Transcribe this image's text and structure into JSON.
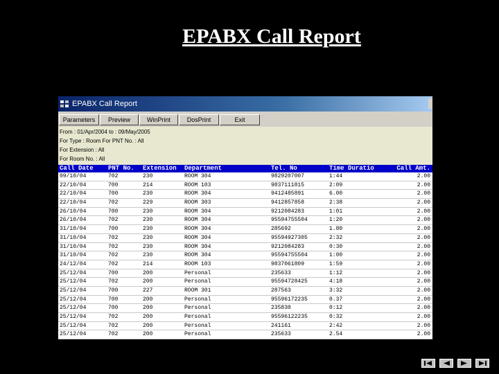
{
  "slide": {
    "title": "EPABX Call Report"
  },
  "window": {
    "title": "EPABX Call Report"
  },
  "toolbar": [
    {
      "label": "Parameters",
      "name": "parameters-button",
      "w": 58
    },
    {
      "label": "Preview",
      "name": "preview-button",
      "w": 56
    },
    {
      "label": "WinPrint",
      "name": "winprint-button",
      "w": 56
    },
    {
      "label": "DosPrint",
      "name": "dosprint-button",
      "w": 58
    },
    {
      "label": "Exit",
      "name": "exit-button",
      "w": 58
    }
  ],
  "params": [
    "From : 01/Apr/2004 to : 09/May/2005",
    "For Type : Room     For PNT No. : All",
    "For Extension : All",
    "For Room No. : All"
  ],
  "columns": [
    "Call Date",
    "PNT No.",
    "Extension",
    "Department",
    "Tel. No",
    "Time Duratio",
    "Call Amt."
  ],
  "rows": [
    [
      "09/10/04",
      "702",
      "230",
      "ROOM 304",
      "9829207007",
      "1:44",
      "2.00"
    ],
    [
      "22/10/04",
      "700",
      "214",
      "ROOM 103",
      "9837111815",
      "2:09",
      "2.00"
    ],
    [
      "22/10/04",
      "700",
      "230",
      "ROOM 304",
      "9412485891",
      "6.00",
      "2.00"
    ],
    [
      "22/10/04",
      "702",
      "229",
      "ROOM 303",
      "9412857858",
      "2:38",
      "2.00"
    ],
    [
      "26/10/04",
      "700",
      "230",
      "ROOM 304",
      "9212084283",
      "1:01",
      "2.00"
    ],
    [
      "26/10/04",
      "702",
      "230",
      "ROOM 304",
      "95594755504",
      "1:20",
      "2.00"
    ],
    [
      "31/10/04",
      "700",
      "230",
      "ROOM 304",
      "285692",
      "1.80",
      "2.00"
    ],
    [
      "31/10/04",
      "702",
      "230",
      "ROOM 304",
      "95594927305",
      "2:32",
      "2.00"
    ],
    [
      "31/10/04",
      "702",
      "230",
      "ROOM 304",
      "9212084283",
      "0:30",
      "2.00"
    ],
    [
      "31/10/04",
      "702",
      "230",
      "ROOM 304",
      "95594755504",
      "1:00",
      "2.00"
    ],
    [
      "24/12/04",
      "702",
      "214",
      "ROOM 103",
      "9837061809",
      "1:59",
      "2.00"
    ],
    [
      "25/12/04",
      "700",
      "200",
      "Personal",
      "235633",
      "1:12",
      "2.00"
    ],
    [
      "25/12/04",
      "702",
      "200",
      "Personal",
      "95594728425",
      "4:18",
      "2.00"
    ],
    [
      "25/12/04",
      "700",
      "227",
      "ROOM 301",
      "287563",
      "3:32",
      "2.00"
    ],
    [
      "25/12/04",
      "700",
      "200",
      "Personal",
      "95596172235",
      "0.37",
      "2.00"
    ],
    [
      "25/12/04",
      "700",
      "200",
      "Personal",
      "235830",
      "0:12",
      "2.00"
    ],
    [
      "25/12/04",
      "702",
      "200",
      "Personal",
      "95596122235",
      "0:32",
      "2.00"
    ],
    [
      "25/12/04",
      "702",
      "200",
      "Personal",
      "241161",
      "2:42",
      "2.00"
    ],
    [
      "25/12/04",
      "702",
      "200",
      "Personal",
      "235633",
      "2.54",
      "2.00"
    ]
  ],
  "nav": [
    {
      "name": "first-slide-button",
      "icon": "first-icon"
    },
    {
      "name": "previous-slide-button",
      "icon": "previous-icon"
    },
    {
      "name": "next-slide-button",
      "icon": "next-icon"
    },
    {
      "name": "last-slide-button",
      "icon": "last-icon"
    }
  ],
  "colors": {
    "header_bg": "#0000c8",
    "titlebar": "#0a246a",
    "params_bg": "#e8e8d0"
  }
}
